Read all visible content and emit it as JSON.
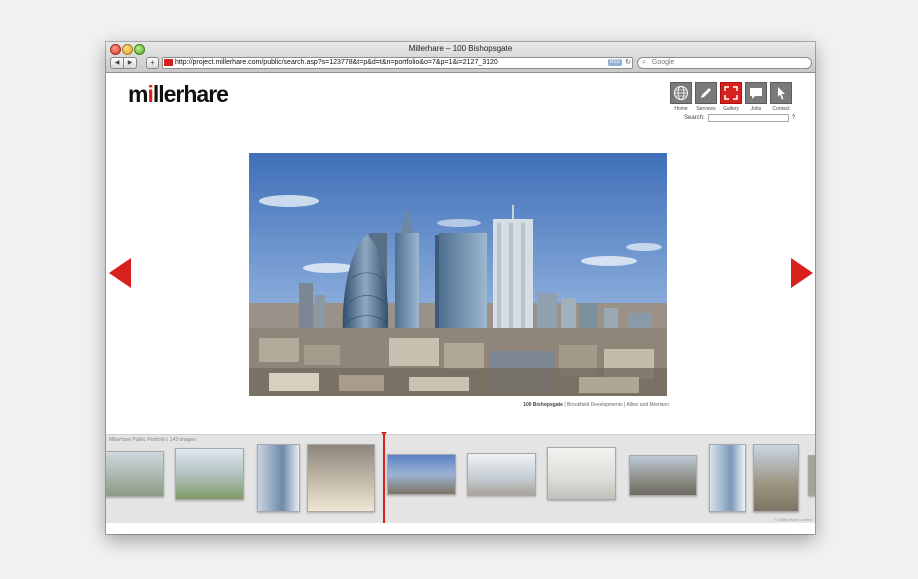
{
  "window": {
    "title": "Millerhare – 100 Bishopsgate",
    "url": "http://project.millerhare.com/public/search.asp?s=123778&t=p&d=t&n=portfolio&o=7&p=1&i=2127_3120",
    "rss_label": "RSS",
    "search_placeholder": "Google"
  },
  "site": {
    "logo_pre": "m",
    "logo_post": "llerhare",
    "nav": [
      {
        "label": "Home",
        "icon": "globe-icon"
      },
      {
        "label": "Services",
        "icon": "pencil-icon"
      },
      {
        "label": "Gallery",
        "icon": "gallery-icon"
      },
      {
        "label": "Jobs",
        "icon": "speech-bubble-icon"
      },
      {
        "label": "Contact",
        "icon": "cursor-icon"
      }
    ],
    "search_label": "Search:",
    "search_help": "?"
  },
  "caption": {
    "title": "100 Bishopsgate",
    "client": "Brookfield Developments",
    "architect": "Allies and Morrison",
    "separator": "|"
  },
  "strip": {
    "label": "Millerhare Public Portfolio",
    "count": "143 images",
    "separator": "|"
  },
  "footer": {
    "copyright": "© Miller Hare Limited"
  },
  "colors": {
    "accent": "#d8211c",
    "icon_grey": "#7a7a7a"
  }
}
